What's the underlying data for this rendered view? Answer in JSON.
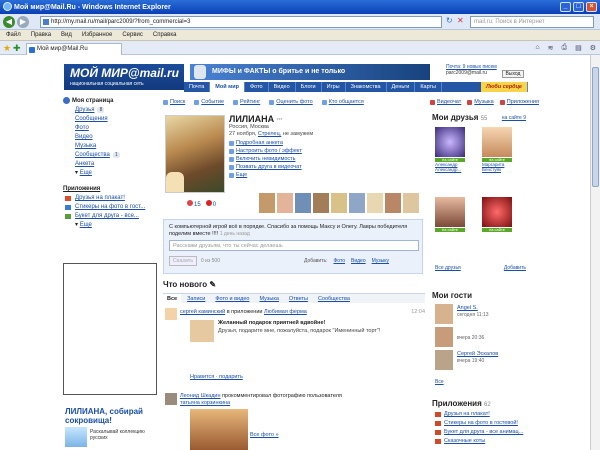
{
  "window": {
    "title": "Мой мир@Mail.Ru - Windows Internet Explorer"
  },
  "address": {
    "url": "http://my.mail.ru/mail/parc2009/?from_commercial=3",
    "search_placeholder": "mail.ru: Поиск в Интернет"
  },
  "menu": [
    "Файл",
    "Правка",
    "Вид",
    "Избранное",
    "Сервис",
    "Справка"
  ],
  "tab": {
    "label": "Мой мир@Mail.Ru"
  },
  "site": {
    "logo_main": "МОЙ МИР@mail.ru",
    "logo_sub": "национальная социальная сеть",
    "banner": "МИФЫ и ФАКТЫ о бритье и не только",
    "mail_line": "Почта: 9 новых писем",
    "email": "parc2009@mail.ru",
    "exit": "Выход",
    "nav": [
      "Почта",
      "Мой мир",
      "Фото",
      "Видео",
      "Блоги",
      "Игры",
      "Знакомства",
      "Деньги",
      "Карты",
      "Люби сердце"
    ]
  },
  "left": {
    "my_page": "Моя страница",
    "items": [
      {
        "label": "Друзья",
        "count": "8"
      },
      {
        "label": "Сообщения",
        "count": ""
      },
      {
        "label": "Фото",
        "count": ""
      },
      {
        "label": "Видео",
        "count": ""
      },
      {
        "label": "Музыка",
        "count": ""
      },
      {
        "label": "Сообщества",
        "count": "1"
      },
      {
        "label": "Анкета",
        "count": ""
      }
    ],
    "more": "Еще",
    "apps_title": "Приложения",
    "apps": [
      "Друзья на плакат!",
      "Стикеры на фото в гост...",
      "Букет для друга - все..."
    ],
    "apps_more": "Еще",
    "promo_title": "ЛИЛИАНА, собирай сокровища!",
    "promo_text": "Раскалывай коллекцию русских"
  },
  "quick": [
    "Поиск",
    "Событие",
    "Рейтинг",
    "Оценить фото",
    "Кто общается",
    "Видеочат",
    "Музыка"
  ],
  "apps_link": "Приложения",
  "profile": {
    "name": "ЛИЛИАНА",
    "stars": "***",
    "city": "Россия, Москва",
    "line2_a": "27 ноября,",
    "line2_b": "Стрелец,",
    "line2_c": "не замужем",
    "actions": [
      "Подробная анкета",
      "Настроить фото / эффект",
      "Включить невидимость",
      "Позвать друга в видеочат",
      "Еще"
    ],
    "stat1": "15",
    "stat2": "0"
  },
  "status": {
    "text": "С компьютерной игрой всё в порядке. Спасибо за помощь Максу и Олегу. Лавры победителя поделим вместе !!!!",
    "time": "1 день назад",
    "share_placeholder": "Расскажи друзьям, что ты сейчас делаешь",
    "share_button": "Сказать",
    "count": "0 из 500",
    "add_label": "Добавить:",
    "add_links": [
      "Фото",
      "Видео",
      "Музыку"
    ]
  },
  "feed": {
    "title": "Что нового",
    "tabs": [
      "Все",
      "Записи",
      "Фото и видео",
      "Музыка",
      "Ответы",
      "Сообщества"
    ],
    "item1_user": "сергей каминский",
    "item1_mid": "в приложении",
    "item1_app": "Любимая ферма",
    "item1_time": "12:04",
    "item1_title": "Желанный подарок приятней вдвойне!",
    "item1_text": "Друзья, подарите мне, пожалуйста, подарок \"Именинный торт\"!",
    "item1_links": "Нравится · подарить",
    "item2_user": "Леонид Шкадин",
    "item2_text": "прокомментировал фотографию пользователя",
    "item2_target": "татьяна корзинкина",
    "item2_more": "Все фото »"
  },
  "friends": {
    "title": "Мои друзья",
    "count": "55",
    "online": "на сайте 9",
    "list": [
      {
        "name": "на сайте",
        "n1": "Александр",
        "n2": "Александр..."
      },
      {
        "name": "на сайте",
        "n1": "Маргарита",
        "n2": "Бенстуйк"
      },
      {
        "name": "на сайте",
        "n1": "",
        "n2": ""
      },
      {
        "name": "на сайте",
        "n1": "",
        "n2": ""
      }
    ],
    "all": "Все друзья",
    "add": "Добавить"
  },
  "guests": {
    "title": "Мои гости",
    "list": [
      {
        "name": "Angel S.",
        "time": "сегодня 11:13"
      },
      {
        "name": "",
        "time": "вчера 20:36"
      },
      {
        "name": "Сергей Эскалов",
        "time": "вчера 19:40"
      }
    ],
    "all": "Все"
  },
  "apps_right": {
    "title": "Приложения",
    "count": "62",
    "list": [
      "Друзья на плакат!",
      "Стикеры на фото в гостевой!",
      "Букет для друга - все анимац...",
      "Сказочные коты"
    ]
  }
}
